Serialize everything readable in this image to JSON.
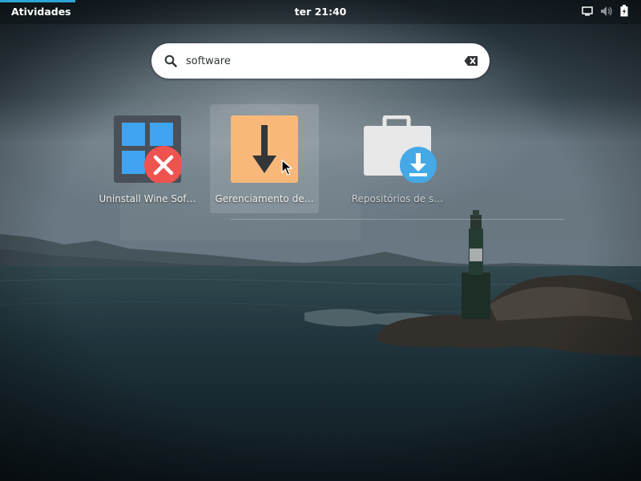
{
  "topbar": {
    "activities_label": "Atividades",
    "clock": "ter 21:40",
    "tray_icons": [
      "display-icon",
      "volume-muted-icon",
      "battery-icon"
    ]
  },
  "search": {
    "value": "software",
    "icon": "search-icon",
    "clear_icon": "clear-backspace-icon"
  },
  "results": {
    "apps": [
      {
        "label": "Uninstall Wine Sof…",
        "icon": "wine-uninstaller-icon",
        "selected": false
      },
      {
        "label": "Gerenciamento de…",
        "icon": "software-download-icon",
        "selected": true
      },
      {
        "label": "Repositórios de s…",
        "icon": "software-sources-icon",
        "selected": false
      }
    ]
  },
  "colors": {
    "accent": "#2aa6d6",
    "panel_bg": "#000000",
    "selected_bg": "#ffffff"
  }
}
